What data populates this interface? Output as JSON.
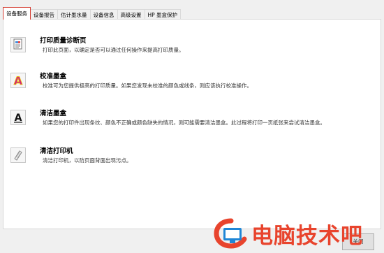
{
  "tabs": [
    {
      "label": "设备服务",
      "active": true
    },
    {
      "label": "设备报告",
      "active": false
    },
    {
      "label": "估计墨水量",
      "active": false
    },
    {
      "label": "设备信息",
      "active": false
    },
    {
      "label": "高级设置",
      "active": false
    },
    {
      "label": "HP 墨盒保护",
      "active": false
    }
  ],
  "services": [
    {
      "title": "打印质量诊断页",
      "desc": "打印此页面，以确定是否可以通过任何操作来提高打印质量。",
      "icon": "print-quality-icon"
    },
    {
      "title": "校准墨盒",
      "desc": "校准可为您提供极高的打印质量。如果您发现未校准的颜色或线条，则应该执行校准操作。",
      "icon": "align-cartridge-icon"
    },
    {
      "title": "清洁墨盒",
      "desc": "如果您的打印件出现条纹、颜色不正确或颜色缺失的情况，则可能需要清洁墨盒。此过程将打印一页纸张来尝试清洁墨盒。",
      "icon": "clean-cartridge-icon"
    },
    {
      "title": "清洁打印机",
      "desc": "清洁打印机，以防页面背面出现污点。",
      "icon": "clean-printer-icon"
    }
  ],
  "close_button": "关闭",
  "watermark": {
    "text": "电脑技术吧",
    "brand_color": "#e8442d",
    "logo_color": "#1f86d6"
  }
}
